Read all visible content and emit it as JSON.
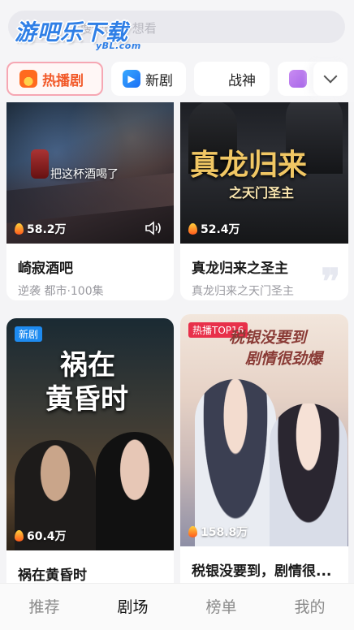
{
  "search": {
    "placeholder": "搜索剧名·想看"
  },
  "logo": {
    "main": "游吧乐下载",
    "sub": "yBL.com"
  },
  "category_tabs": [
    {
      "label": "热播剧",
      "icon": "flame-icon",
      "active": true
    },
    {
      "label": "新剧",
      "icon": "play-square-icon",
      "active": false
    },
    {
      "label": "战神",
      "icon": "crossed-swords-icon",
      "active": false
    },
    {
      "label": "",
      "icon": "person-icon",
      "active": false
    }
  ],
  "cards": [
    {
      "title": "崎寂酒吧",
      "subtitle": "逆袭 都市·100集",
      "heat": "58.2万",
      "caption": "把这杯酒喝了",
      "badge": "",
      "poster_title": ""
    },
    {
      "title": "真龙归来之圣主",
      "subtitle": "真龙归来之天门圣主",
      "heat": "52.4万",
      "caption": "",
      "badge": "",
      "poster_title": "真龙归来",
      "poster_subtitle": "之天门圣主"
    },
    {
      "title": "祸在黄昏时",
      "subtitle": "",
      "heat": "60.4万",
      "caption": "",
      "badge": "新剧",
      "poster_title_line1": "祸在",
      "poster_title_line2": "黄昏时"
    },
    {
      "title": "税银没要到，剧情很...",
      "subtitle": "",
      "heat": "158.8万",
      "caption": "",
      "badge": "热播TOP16",
      "poster_title_line1": "税银没要到",
      "poster_title_line2": "剧情很劲爆"
    }
  ],
  "bottom_nav": [
    {
      "label": "推荐",
      "active": false
    },
    {
      "label": "剧场",
      "active": true
    },
    {
      "label": "榜单",
      "active": false
    },
    {
      "label": "我的",
      "active": false
    }
  ],
  "colors": {
    "accent": "#f25a2a",
    "logo_blue": "#2f7fe6",
    "badge_new": "#1e8bf0",
    "badge_hot": "#e8304a"
  }
}
